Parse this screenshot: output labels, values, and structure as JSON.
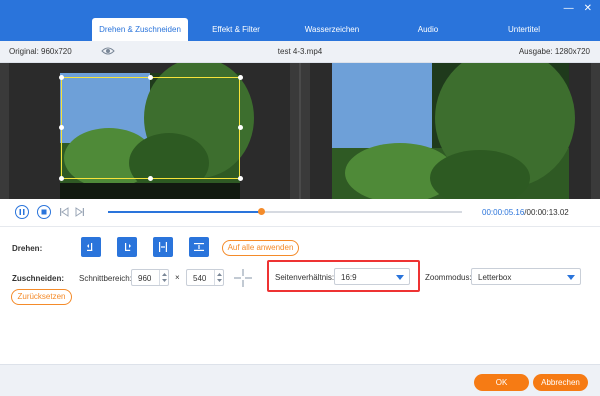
{
  "tabs": [
    "Drehen & Zuschneiden",
    "Effekt & Filter",
    "Wasserzeichen",
    "Audio",
    "Untertitel"
  ],
  "window": {
    "minimize": "—",
    "close": "✕"
  },
  "info": {
    "original": "Original: 960x720",
    "filename": "test 4-3.mp4",
    "output": "Ausgabe: 1280x720"
  },
  "playback": {
    "progress": 0.435,
    "current_time": "00:00:05.16",
    "total_time": "/00:00:13.02"
  },
  "rotate": {
    "label": "Drehen:",
    "apply_all": "Auf alle anwenden",
    "buttons": [
      "rotate-left",
      "rotate-right",
      "flip-horizontal",
      "flip-vertical"
    ]
  },
  "crop": {
    "label": "Zuschneiden:",
    "area_label": "Schnittbereich:",
    "width": "960",
    "times": "×",
    "height": "540",
    "reset": "Zurücksetzen",
    "aspect_label": "Seitenverhältnis:",
    "aspect_value": "16:9",
    "zoom_label": "Zoommodus:",
    "zoom_value": "Letterbox"
  },
  "footer": {
    "ok": "OK",
    "cancel": "Abbrechen"
  },
  "colors": {
    "accent": "#2a74db",
    "orange": "#f67b14",
    "highlight": "#e33333",
    "crop": "#f6e33b"
  }
}
